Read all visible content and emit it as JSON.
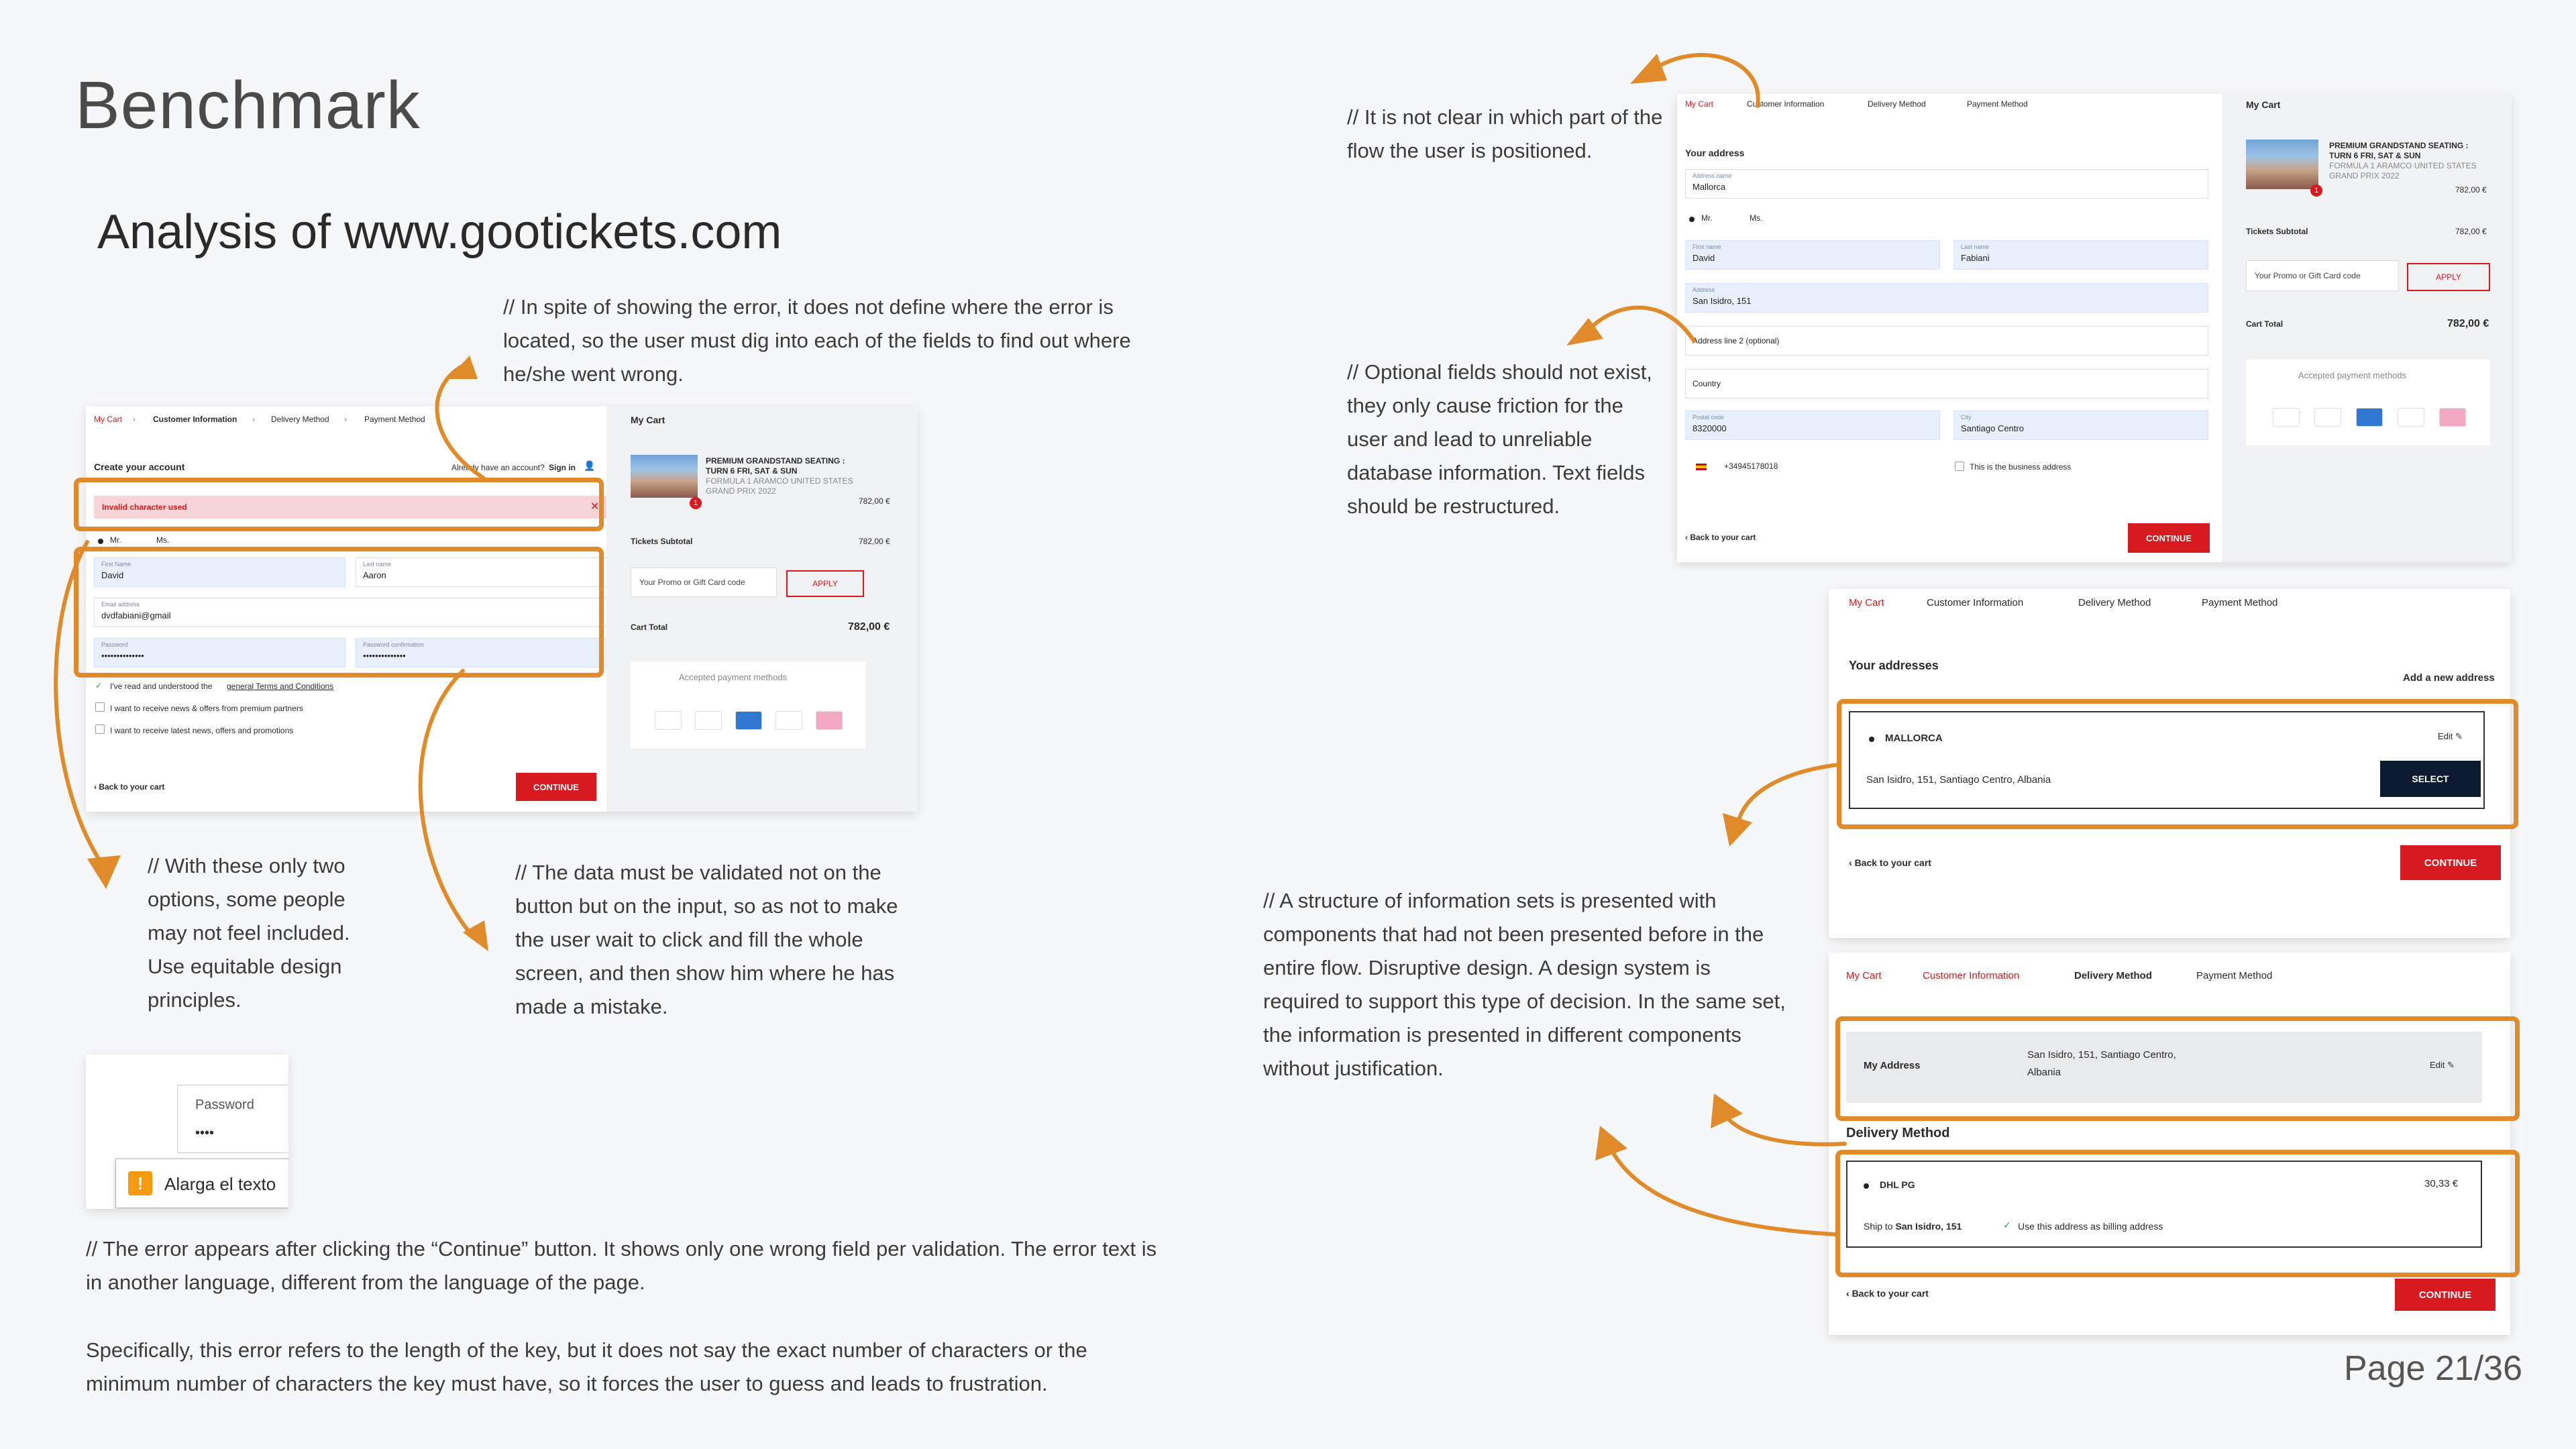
{
  "page": {
    "title": "Benchmark",
    "subtitle": "Analysis of www.gootickets.com",
    "page_number": "Page 21/36",
    "accent_color": "#e08a2a",
    "brand_red": "#d71920"
  },
  "notes": {
    "error_location": "// In spite of showing the error, it does not define where the error is located, so the user must dig into each of the fields to find out where he/she went wrong.",
    "two_options": "// With these only two options, some people may not feel included. Use equitable design principles.",
    "validation": "// The data must be validated not on the button but on the input, so as not to make the user wait to click and fill the whole screen, and then show him where he has made a mistake.",
    "error_click_1": "// The error appears after clicking the “Continue” button. It shows only one wrong field per validation. The error text is in another language, different from the language of the page.",
    "error_click_2": "Specifically, this error refers to the length of the key, but it does not say the exact number of characters or the minimum number of characters the key must have, so it forces the user to guess and leads to frustration.",
    "flow_position": "// It is not clear in which part of the flow the user is positioned.",
    "optional_fields": "// Optional fields should not exist, they only cause friction for the user and lead to unreliable database information. Text fields should be restructured.",
    "info_sets": "// A structure of information sets is presented with components that had not been presented before in the entire flow. Disruptive design. A design system is required to support this type of decision. In the same set, the information is presented in different components without justification."
  },
  "breadcrumb": {
    "my_cart": "My Cart",
    "customer_info": "Customer Information",
    "delivery": "Delivery Method",
    "payment": "Payment Method"
  },
  "account_form": {
    "heading": "Create your account",
    "already": "Already have an account?",
    "sign_in": "Sign in",
    "error": "Invalid character used",
    "mr": "Mr.",
    "ms": "Ms.",
    "first_name_label": "First Name",
    "first_name": "David",
    "last_name_label": "Last name",
    "last_name": "Aaron",
    "email_label": "Email address",
    "email": "dvdfabiani@gmail",
    "password_label": "Password",
    "password": "••••••••••••••",
    "password_conf_label": "Password confirmation",
    "password_conf": "••••••••••••••",
    "terms_prefix": "I've read and understood the",
    "terms_link": "general Terms and Conditions",
    "news_partners": "I want to receive news & offers from premium partners",
    "news_latest": "I want to receive latest news, offers and promotions",
    "back": "Back to your cart",
    "continue": "CONTINUE"
  },
  "cart": {
    "title": "My Cart",
    "product_1": "PREMIUM GRANDSTAND SEATING :",
    "product_2": "TURN 6 FRI, SAT & SUN",
    "product_3": "FORMULA 1 ARAMCO UNITED STATES",
    "product_4": "GRAND PRIX 2022",
    "price": "782,00 €",
    "qty": "1",
    "subtotal_label": "Tickets Subtotal",
    "subtotal": "782,00 €",
    "promo_placeholder": "Your Promo or Gift Card code",
    "apply": "APPLY",
    "total_label": "Cart Total",
    "total": "782,00 €",
    "accepted": "Accepted payment methods",
    "cards": [
      "VISA",
      "MC",
      "AMEX",
      "iD",
      "KL"
    ]
  },
  "tooltip": {
    "label": "Password",
    "value": "••••",
    "message": "Alarga el texto",
    "icon": "warning-icon"
  },
  "address_form": {
    "heading": "Your address",
    "address_name_label": "Address name",
    "address_name": "Mallorca",
    "mr": "Mr.",
    "ms": "Ms.",
    "first_name_label": "First name",
    "first_name": "David",
    "last_name_label": "Last name",
    "last_name": "Fabiani",
    "address_label": "Address",
    "address": "San Isidro, 151",
    "address2": "Address line 2 (optional)",
    "country": "Country",
    "postal_label": "Postal code",
    "postal": "8320000",
    "city_label": "City",
    "city": "Santiago Centro",
    "phone": "+34945178018",
    "business": "This is the business address",
    "back": "Back to your cart",
    "continue": "CONTINUE"
  },
  "addresses": {
    "heading": "Your addresses",
    "add_new": "Add a new address",
    "name": "MALLORCA",
    "edit": "Edit",
    "line": "San Isidro, 151, Santiago Centro, Albania",
    "select": "SELECT",
    "back": "Back to your cart",
    "continue": "CONTINUE"
  },
  "delivery_screen": {
    "my_address": "My Address",
    "address_line_1": "San Isidro, 151, Santiago Centro,",
    "address_line_2": "Albania",
    "edit": "Edit",
    "section": "Delivery Method",
    "carrier": "DHL PG",
    "price": "30,33 €",
    "ship_prefix": "Ship to",
    "ship_to": "San Isidro, 151",
    "billing": "Use this address as billing address",
    "back": "Back to your cart",
    "continue": "CONTINUE"
  }
}
